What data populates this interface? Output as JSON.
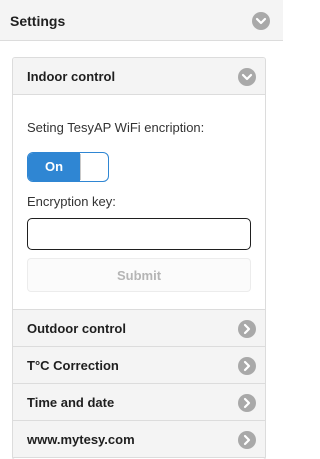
{
  "header": {
    "title": "Settings",
    "icon": "chevron-down-icon"
  },
  "indoor": {
    "title": "Indoor control",
    "wifi_label": "Seting TesyAP WiFi encription:",
    "toggle": {
      "label": "On",
      "state": "on"
    },
    "key_label": "Encryption key:",
    "key_value": "",
    "submit_label": "Submit"
  },
  "sections": [
    {
      "label": "Outdoor control",
      "icon": "chevron-right-icon"
    },
    {
      "label": "T°C Correction",
      "icon": "chevron-right-icon"
    },
    {
      "label": "Time and date",
      "icon": "chevron-right-icon"
    },
    {
      "label": "www.mytesy.com",
      "icon": "chevron-right-icon"
    }
  ],
  "colors": {
    "accent": "#2f86d3",
    "chevron": "#a9a9a9",
    "header_bg": "#f4f4f4"
  }
}
